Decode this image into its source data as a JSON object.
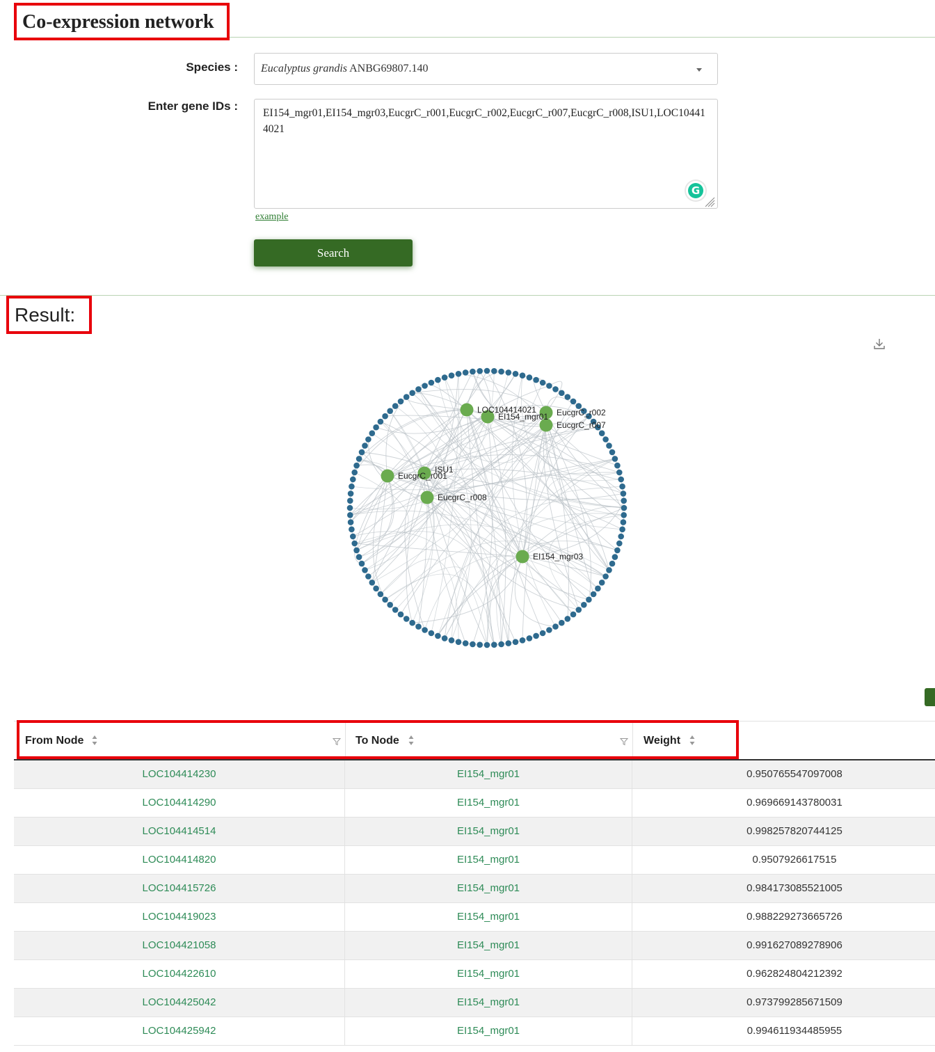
{
  "header": {
    "title": "Co-expression network"
  },
  "form": {
    "species_label": "Species :",
    "species_genus": "Eucalyptus grandis",
    "species_strain": "ANBG69807.140",
    "gene_label": "Enter gene IDs :",
    "gene_value": "EI154_mgr01,EI154_mgr03,EucgrC_r001,EucgrC_r002,EucgrC_r007,EucgrC_r008,ISU1,LOC104414021",
    "example_link": "example",
    "search_button": "Search"
  },
  "result": {
    "title": "Result:"
  },
  "network": {
    "query_color": "#6aab4f",
    "ring_color": "#2e6a8e",
    "edge_color": "#b8bfc4",
    "ring_node_count": 120,
    "nodes": [
      "LOC104414021",
      "EI154_mgr01",
      "EucgrC_r002",
      "EucgrC_r007",
      "EucgrC_r001",
      "ISU1",
      "EucgrC_r008",
      "EI154_mgr03"
    ]
  },
  "table": {
    "columns": [
      "From Node",
      "To Node",
      "Weight"
    ],
    "rows": [
      [
        "LOC104414230",
        "EI154_mgr01",
        "0.950765547097008"
      ],
      [
        "LOC104414290",
        "EI154_mgr01",
        "0.969669143780031"
      ],
      [
        "LOC104414514",
        "EI154_mgr01",
        "0.998257820744125"
      ],
      [
        "LOC104414820",
        "EI154_mgr01",
        "0.9507926617515"
      ],
      [
        "LOC104415726",
        "EI154_mgr01",
        "0.984173085521005"
      ],
      [
        "LOC104419023",
        "EI154_mgr01",
        "0.988229273665726"
      ],
      [
        "LOC104421058",
        "EI154_mgr01",
        "0.991627089278906"
      ],
      [
        "LOC104422610",
        "EI154_mgr01",
        "0.962824804212392"
      ],
      [
        "LOC104425042",
        "EI154_mgr01",
        "0.973799285671509"
      ],
      [
        "LOC104425942",
        "EI154_mgr01",
        "0.994611934485955"
      ]
    ]
  }
}
